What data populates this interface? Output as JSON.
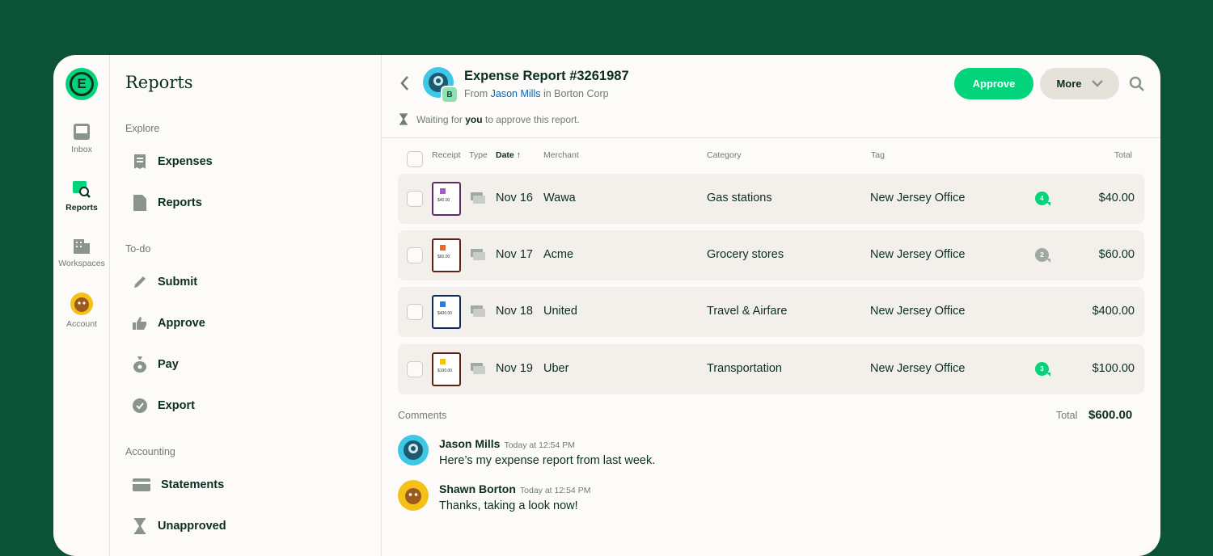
{
  "nav": {
    "items": [
      {
        "label": "Inbox",
        "icon": "inbox-icon"
      },
      {
        "label": "Reports",
        "icon": "reports-icon",
        "active": true
      },
      {
        "label": "Workspaces",
        "icon": "building-icon"
      },
      {
        "label": "Account",
        "icon": "avatar"
      }
    ]
  },
  "lhn": {
    "title": "Reports",
    "sections": [
      {
        "label": "Explore",
        "items": [
          {
            "label": "Expenses",
            "icon": "receipt-icon"
          },
          {
            "label": "Reports",
            "icon": "document-icon"
          }
        ]
      },
      {
        "label": "To-do",
        "items": [
          {
            "label": "Submit",
            "icon": "pencil-icon"
          },
          {
            "label": "Approve",
            "icon": "thumbs-up-icon"
          },
          {
            "label": "Pay",
            "icon": "money-bag-icon"
          },
          {
            "label": "Export",
            "icon": "check-circle-icon"
          }
        ]
      },
      {
        "label": "Accounting",
        "items": [
          {
            "label": "Statements",
            "icon": "card-icon"
          },
          {
            "label": "Unapproved",
            "icon": "hourglass-icon"
          }
        ]
      }
    ]
  },
  "header": {
    "title": "Expense Report #3261987",
    "from_prefix": "From",
    "from_name": "Jason Mills",
    "from_in": "in Borton Corp",
    "badge": "B",
    "wait_prefix": "Waiting for",
    "wait_you": "you",
    "wait_suffix": "to approve this report.",
    "approve_label": "Approve",
    "more_label": "More"
  },
  "columns": {
    "receipt": "Receipt",
    "type": "Type",
    "date": "Date",
    "merchant": "Merchant",
    "category": "Category",
    "tag": "Tag",
    "total": "Total"
  },
  "rows": [
    {
      "date": "Nov 16",
      "merchant": "Wawa",
      "category": "Gas stations",
      "tag": "New Jersey Office",
      "comments": "4",
      "comment_color": "#03d47c",
      "total": "$40.00",
      "receipt_color": "#5b2d6e",
      "receipt_amount": "$40.00"
    },
    {
      "date": "Nov 17",
      "merchant": "Acme",
      "category": "Grocery stores",
      "tag": "New Jersey Office",
      "comments": "2",
      "comment_color": "#a2a9a3",
      "total": "$60.00",
      "receipt_color": "#5b2313",
      "receipt_amount": "$60.00"
    },
    {
      "date": "Nov 18",
      "merchant": "United",
      "category": "Travel & Airfare",
      "tag": "New Jersey Office",
      "comments": "",
      "comment_color": "",
      "total": "$400.00",
      "receipt_color": "#0f2a5c",
      "receipt_amount": "$400.00"
    },
    {
      "date": "Nov 19",
      "merchant": "Uber",
      "category": "Transportation",
      "tag": "New Jersey Office",
      "comments": "3",
      "comment_color": "#03d47c",
      "total": "$100.00",
      "receipt_color": "#5b2313",
      "receipt_amount": "$100.00"
    }
  ],
  "comments": {
    "label": "Comments",
    "total_label": "Total",
    "total_value": "$600.00",
    "items": [
      {
        "name": "Jason Mills",
        "time": "Today at 12:54 PM",
        "text": "Here’s my expense report from last week."
      },
      {
        "name": "Shawn Borton",
        "time": "Today at 12:54 PM",
        "text": "Thanks, taking a look now!"
      }
    ]
  },
  "colors": {
    "accent": "#03d47c",
    "background": "#0b5237",
    "link": "#0164bf"
  }
}
